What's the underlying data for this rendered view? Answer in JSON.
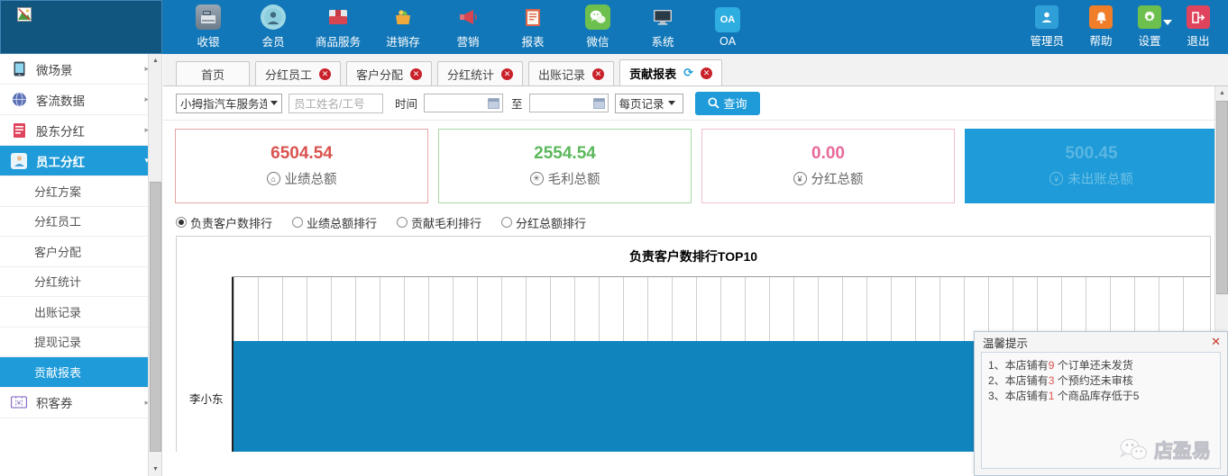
{
  "header": {
    "logo_alt": "broken-image",
    "nav": [
      {
        "label": "收银",
        "icon": "cash-register-icon",
        "color": "#7f8fa0"
      },
      {
        "label": "会员",
        "icon": "member-icon",
        "color": "#7ec8d8"
      },
      {
        "label": "商品服务",
        "icon": "goods-icon",
        "color": "#d94b4b"
      },
      {
        "label": "进销存",
        "icon": "inventory-icon",
        "color": "#e8a33d"
      },
      {
        "label": "营销",
        "icon": "megaphone-icon",
        "color": "#d94b4b"
      },
      {
        "label": "报表",
        "icon": "report-icon",
        "color": "#d06a4a"
      },
      {
        "label": "微信",
        "icon": "wechat-icon",
        "color": "#6ec04e"
      },
      {
        "label": "系统",
        "icon": "system-monitor-icon",
        "color": "#3a4a58"
      },
      {
        "label": "OA",
        "icon": "oa-icon",
        "color": "#2eaee0"
      }
    ],
    "right": [
      {
        "label": "管理员",
        "icon": "user-admin-icon",
        "color": "#2f9fd8"
      },
      {
        "label": "帮助",
        "icon": "bell-help-icon",
        "color": "#f07d28"
      },
      {
        "label": "设置",
        "icon": "gear-icon",
        "color": "#6ec04e",
        "has_caret": true
      },
      {
        "label": "退出",
        "icon": "logout-icon",
        "color": "#e0445c"
      }
    ]
  },
  "sidebar": {
    "items": [
      {
        "label": "微场景",
        "icon": "mobile-icon",
        "color": "#3a4a58",
        "arrow": "▸",
        "type": "top"
      },
      {
        "label": "客流数据",
        "icon": "globe-icon",
        "color": "#5b6fb5",
        "arrow": "▸",
        "type": "top"
      },
      {
        "label": "股东分红",
        "icon": "document-icon",
        "color": "#e0445c",
        "arrow": "▸",
        "type": "top"
      },
      {
        "label": "员工分红",
        "icon": "person-icon",
        "color": "#4a9fd8",
        "arrow": "▾",
        "type": "top",
        "active": true
      }
    ],
    "sub_items": [
      {
        "label": "分红方案"
      },
      {
        "label": "分红员工"
      },
      {
        "label": "客户分配"
      },
      {
        "label": "分红统计"
      },
      {
        "label": "出账记录"
      },
      {
        "label": "提现记录"
      },
      {
        "label": "贡献报表",
        "active": true
      }
    ],
    "bottom_items": [
      {
        "label": "积客券",
        "icon": "coupon-icon",
        "color": "#8a6fc4",
        "arrow": "▸",
        "type": "top"
      }
    ]
  },
  "tabs": [
    {
      "label": "首页",
      "closable": false
    },
    {
      "label": "分红员工",
      "closable": true
    },
    {
      "label": "客户分配",
      "closable": true
    },
    {
      "label": "分红统计",
      "closable": true
    },
    {
      "label": "出账记录",
      "closable": true
    },
    {
      "label": "贡献报表",
      "closable": true,
      "active": true,
      "refresh": true
    }
  ],
  "toolbar": {
    "shop_select": "小拇指汽车服务连",
    "employee_placeholder": "员工姓名/工号",
    "employee_value": "",
    "time_label": "时间",
    "date_from": "",
    "date_to": "",
    "to_label": "至",
    "page_size_select": "每页记录",
    "search_label": "查询",
    "search_icon": "search-icon"
  },
  "cards": [
    {
      "value": "6504.54",
      "label": "业绩总额",
      "icon": "performance-icon",
      "glyph": "⌂",
      "color": "#d9534f",
      "border": "#e8a5a5",
      "selected": false
    },
    {
      "value": "2554.54",
      "label": "毛利总额",
      "icon": "profit-icon",
      "glyph": "✳",
      "color": "#5cb85c",
      "border": "#a8d8a8",
      "selected": false
    },
    {
      "value": "0.00",
      "label": "分红总额",
      "icon": "dividend-icon",
      "glyph": "¥",
      "color": "#e8699a",
      "border": "#f0bcd0",
      "selected": false
    },
    {
      "value": "500.45",
      "label": "未出账总额",
      "icon": "unbilled-icon",
      "glyph": "¥",
      "color": "#59b6e2",
      "border": "#1e9bd8",
      "selected": true
    }
  ],
  "radios": [
    {
      "label": "负责客户数排行",
      "checked": true
    },
    {
      "label": "业绩总额排行",
      "checked": false
    },
    {
      "label": "贡献毛利排行",
      "checked": false
    },
    {
      "label": "分红总额排行",
      "checked": false
    }
  ],
  "popup": {
    "title": "温馨提示",
    "close_icon": "close-icon",
    "lines": [
      {
        "prefix": "1、本店铺有",
        "num": "9",
        "suffix": " 个订单还未发货"
      },
      {
        "prefix": "2、本店铺有",
        "num": "3",
        "suffix": " 个预约还未审核"
      },
      {
        "prefix": "3、本店铺有",
        "num": "1",
        "suffix": " 个商品库存低于5"
      }
    ],
    "watermark_text": "店盈易",
    "watermark_icon": "wechat-icon"
  },
  "chart_data": {
    "type": "bar",
    "orientation": "horizontal",
    "title": "负责客户数排行TOP10",
    "categories": [
      "李小东"
    ],
    "values": [
      100
    ],
    "series": [
      {
        "name": "负责客户数",
        "values": [
          100
        ]
      }
    ],
    "xlabel": "",
    "ylabel": "",
    "xlim": [
      0,
      100
    ],
    "grid": true,
    "legend": false,
    "bar_color": "#1085bd",
    "gridline_color": "#cfcfcf"
  }
}
